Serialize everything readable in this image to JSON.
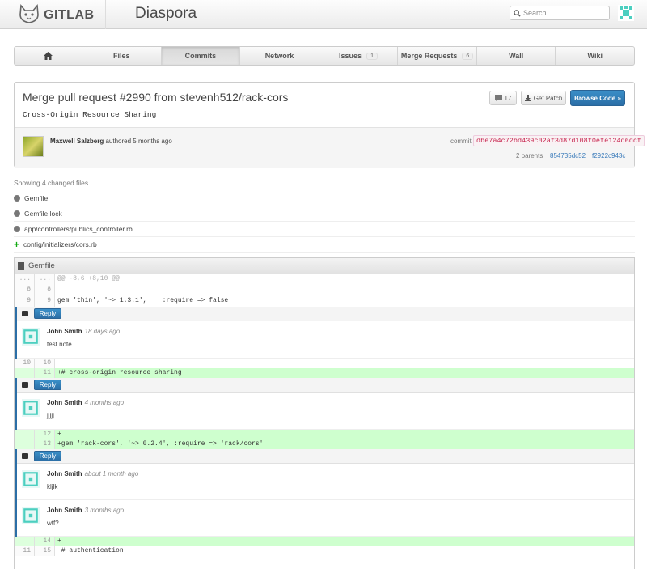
{
  "header": {
    "brand": "GITLAB",
    "project": "Diaspora",
    "search_placeholder": "Search"
  },
  "nav": {
    "items": [
      {
        "label": "",
        "icon": "home-icon"
      },
      {
        "label": "Files"
      },
      {
        "label": "Commits",
        "active": true
      },
      {
        "label": "Network"
      },
      {
        "label": "Issues",
        "badge": "1"
      },
      {
        "label": "Merge Requests",
        "badge": "6"
      },
      {
        "label": "Wall"
      },
      {
        "label": "Wiki"
      }
    ]
  },
  "commit": {
    "title": "Merge pull request #2990 from stevenh512/rack-cors",
    "description": "Cross-Origin Resource Sharing",
    "comments_count": "17",
    "get_patch_label": "Get Patch",
    "browse_code_label": "Browse Code »",
    "author_name": "Maxwell Salzberg",
    "authored_text": "authored 5 months ago",
    "commit_label": "commit",
    "sha": "dbe7a4c72bd439c02af3d87d108f0efe124d6dcf",
    "parents_label": "2 parents",
    "parents": [
      "854735dc52",
      "f2922c943c"
    ]
  },
  "changed_files": {
    "summary": "Showing 4 changed files",
    "files": [
      {
        "name": "Gemfile",
        "status": "modified"
      },
      {
        "name": "Gemfile.lock",
        "status": "modified"
      },
      {
        "name": "app/controllers/publics_controller.rb",
        "status": "modified"
      },
      {
        "name": "config/initializers/cors.rb",
        "status": "added"
      }
    ]
  },
  "diff": {
    "file_name": "Gemfile",
    "reply_label": "Reply",
    "lines": {
      "meta_old": "...",
      "meta_new": "...",
      "meta_code": "@@ -8,6 +8,10 @@",
      "l8_old": "8",
      "l8_new": "8",
      "l8_code": "",
      "l9_old": "9",
      "l9_new": "9",
      "l9_code": "gem 'thin', '~> 1.3.1',    :require => false",
      "l10_old": "10",
      "l10_new": "10",
      "l10_code": "",
      "l11_new": "11",
      "l11_code": "+# cross-origin resource sharing",
      "l12_new": "12",
      "l12_code": "+",
      "l13_new": "13",
      "l13_code": "+gem 'rack-cors', '~> 0.2.4', :require => 'rack/cors'",
      "l14_new": "14",
      "l14_code": "+",
      "l15_old": "11",
      "l15_new": "15",
      "l15_code": " # authentication"
    },
    "notes": [
      {
        "author": "John Smith",
        "time": "18 days ago",
        "body": "test note"
      },
      {
        "author": "John Smith",
        "time": "4 months ago",
        "body": "jjjjj"
      },
      {
        "author": "John Smith",
        "time": "about 1 month ago",
        "body": "kljlk"
      },
      {
        "author": "John Smith",
        "time": "3 months ago",
        "body": "wtf?"
      }
    ]
  },
  "colors": {
    "primary": "#2b6ea6",
    "added_line": "#ceffce",
    "sha_text": "#c7254e"
  }
}
